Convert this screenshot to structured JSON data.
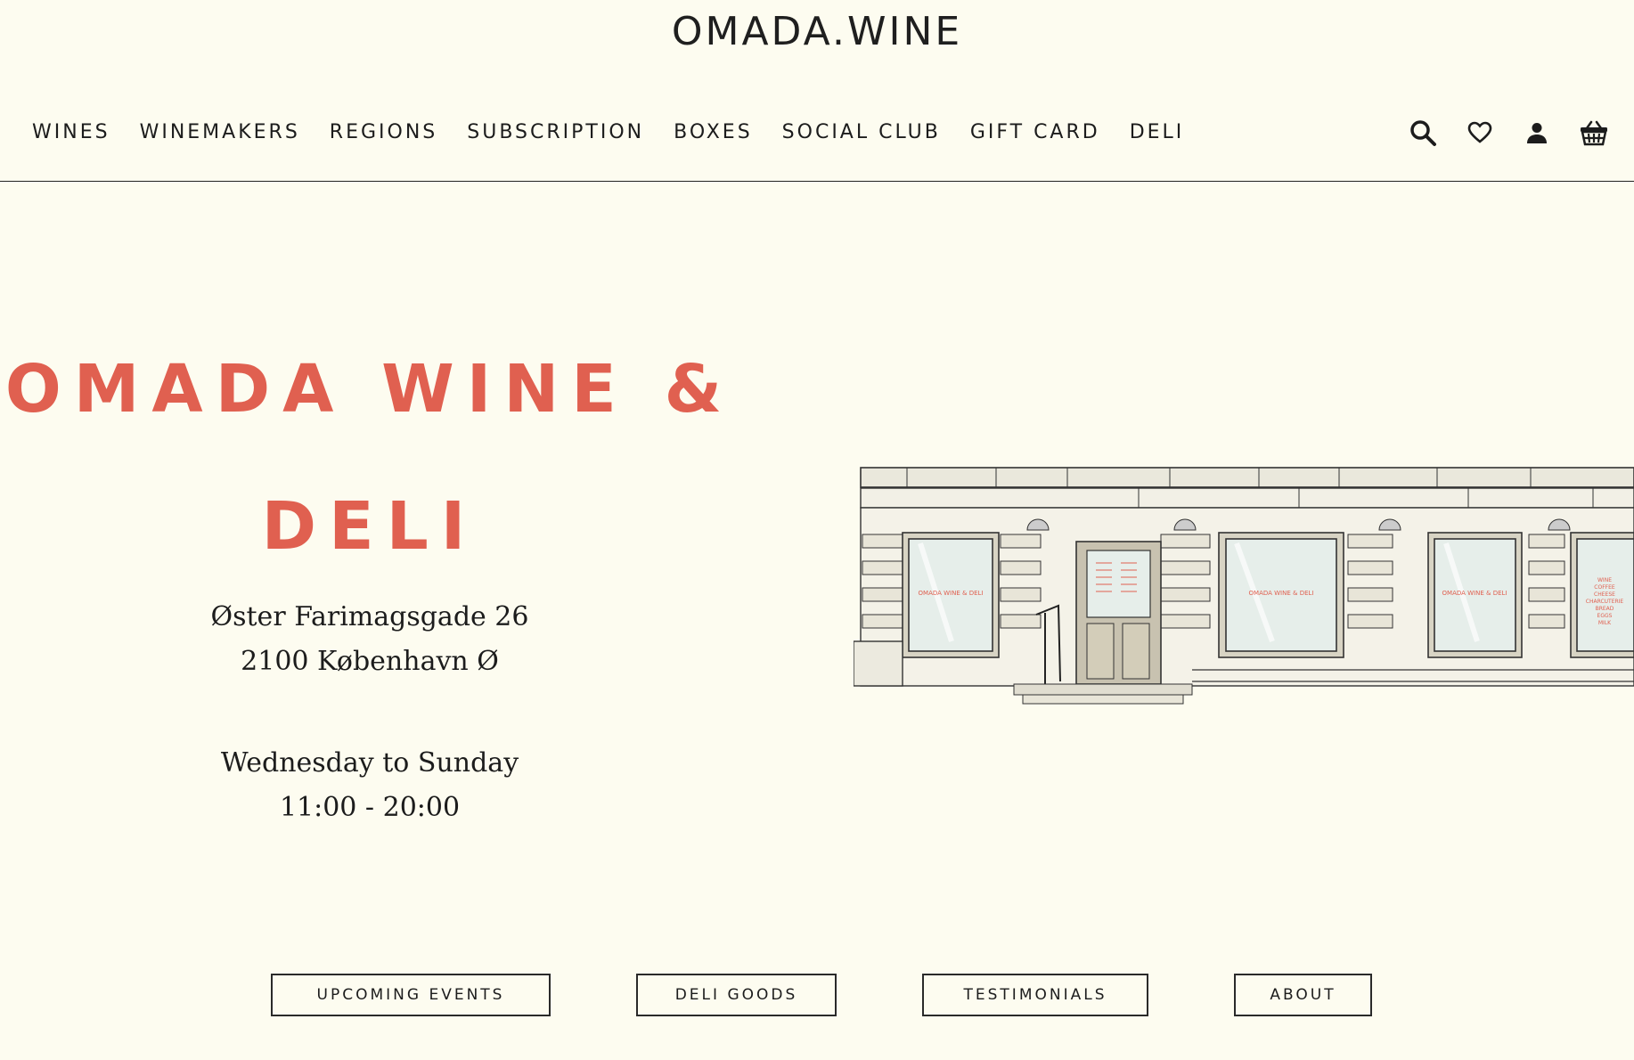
{
  "header": {
    "logo": "OMADA.WINE",
    "nav": [
      "WINES",
      "WINEMAKERS",
      "REGIONS",
      "SUBSCRIPTION",
      "BOXES",
      "SOCIAL CLUB",
      "GIFT CARD",
      "DELI"
    ],
    "icons": [
      "search-icon",
      "heart-icon",
      "user-icon",
      "basket-icon"
    ]
  },
  "hero": {
    "title_line1": "OMADA WINE &",
    "title_line2": "DELI",
    "address_line1": "Øster Farimagsgade 26",
    "address_line2": "2100 København Ø",
    "hours_days": "Wednesday to Sunday",
    "hours_time": "11:00 - 20:00"
  },
  "storefront": {
    "sign_text": "OMADA WINE & DELI",
    "window_list": [
      "WINE",
      "COFFEE",
      "CHEESE",
      "CHARCUTERIE",
      "BREAD",
      "EGGS",
      "MILK"
    ]
  },
  "buttons": {
    "events": "UPCOMING EVENTS",
    "deli_goods": "DELI GOODS",
    "testimonials": "TESTIMONIALS",
    "about": "ABOUT"
  },
  "colors": {
    "background": "#fdfcf0",
    "accent": "#e06050",
    "text": "#1c1c1c"
  }
}
